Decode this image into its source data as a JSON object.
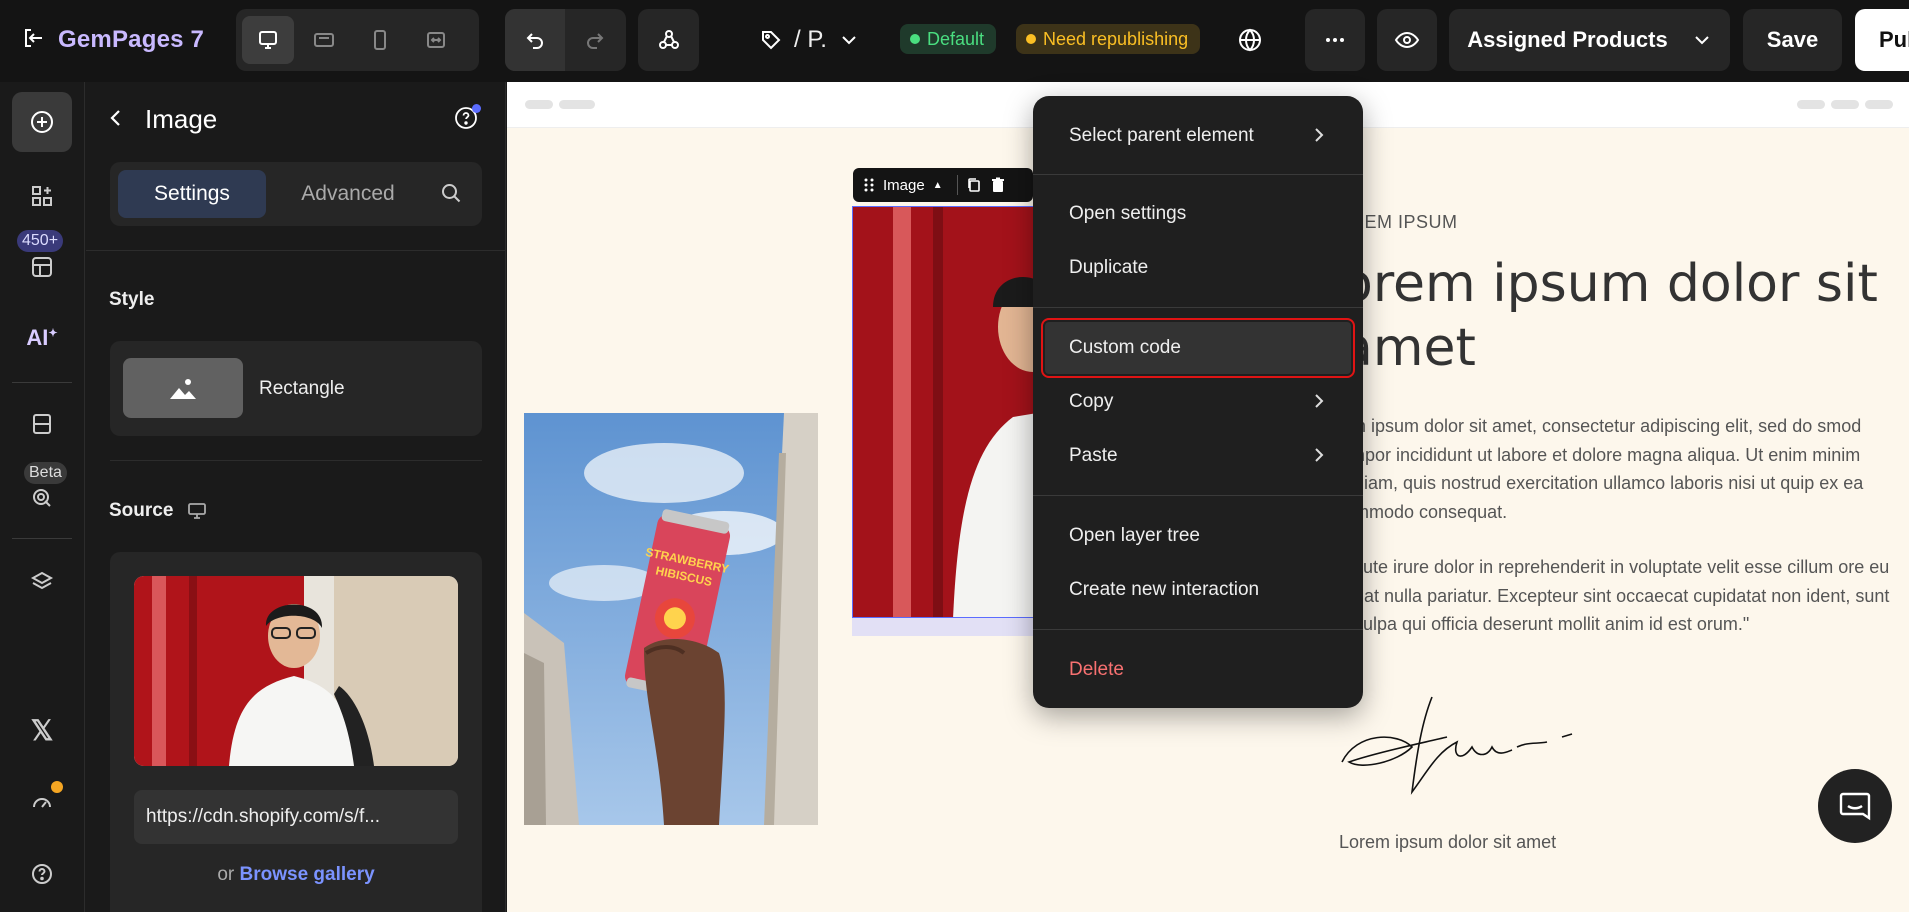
{
  "app": {
    "name": "GemPages",
    "version": "7"
  },
  "topbar": {
    "page_name": "/ P.",
    "badges": {
      "default": "Default",
      "republish": "Need republishing"
    },
    "assigned_label": "Assigned Products",
    "save_label": "Save",
    "publish_label": "Pul"
  },
  "rail": {
    "elements_count": "450+",
    "beta_label": "Beta",
    "ai_label": "AI"
  },
  "panel": {
    "title": "Image",
    "tabs": {
      "settings": "Settings",
      "advanced": "Advanced"
    },
    "style": {
      "title": "Style",
      "option": "Rectangle"
    },
    "source": {
      "title": "Source",
      "url": "https://cdn.shopify.com/s/f...",
      "or_label": "or",
      "browse_label": "Browse gallery"
    }
  },
  "canvas": {
    "element_label": "Image",
    "eyebrow": "REM IPSUM",
    "headline": "orem ipsum dolor sit amet",
    "paragraph1": "rem ipsum dolor sit amet, consectetur adipiscing elit, sed do smod tempor incididunt ut labore et dolore magna aliqua. Ut enim minim veniam, quis nostrud exercitation ullamco laboris nisi ut quip ex ea commodo consequat.",
    "paragraph2": "is aute irure dolor in reprehenderit in voluptate velit esse cillum ore eu fugiat nulla pariatur. Excepteur sint occaecat cupidatat non ident, sunt in culpa qui officia deserunt mollit anim id est orum.\"",
    "caption": "Lorem ipsum dolor sit amet",
    "can_text_line1": "STRAWBERRY",
    "can_text_line2": "HIBISCUS"
  },
  "context_menu": {
    "select_parent": "Select parent element",
    "open_settings": "Open settings",
    "duplicate": "Duplicate",
    "custom_code": "Custom code",
    "copy": "Copy",
    "paste": "Paste",
    "open_layer_tree": "Open layer tree",
    "create_interaction": "Create new interaction",
    "delete": "Delete"
  },
  "colors": {
    "accent": "#7b93ff",
    "highlight_border": "#e01414",
    "danger": "#f87171",
    "badge_green": "#4ade80",
    "badge_yellow": "#fbbf24"
  }
}
